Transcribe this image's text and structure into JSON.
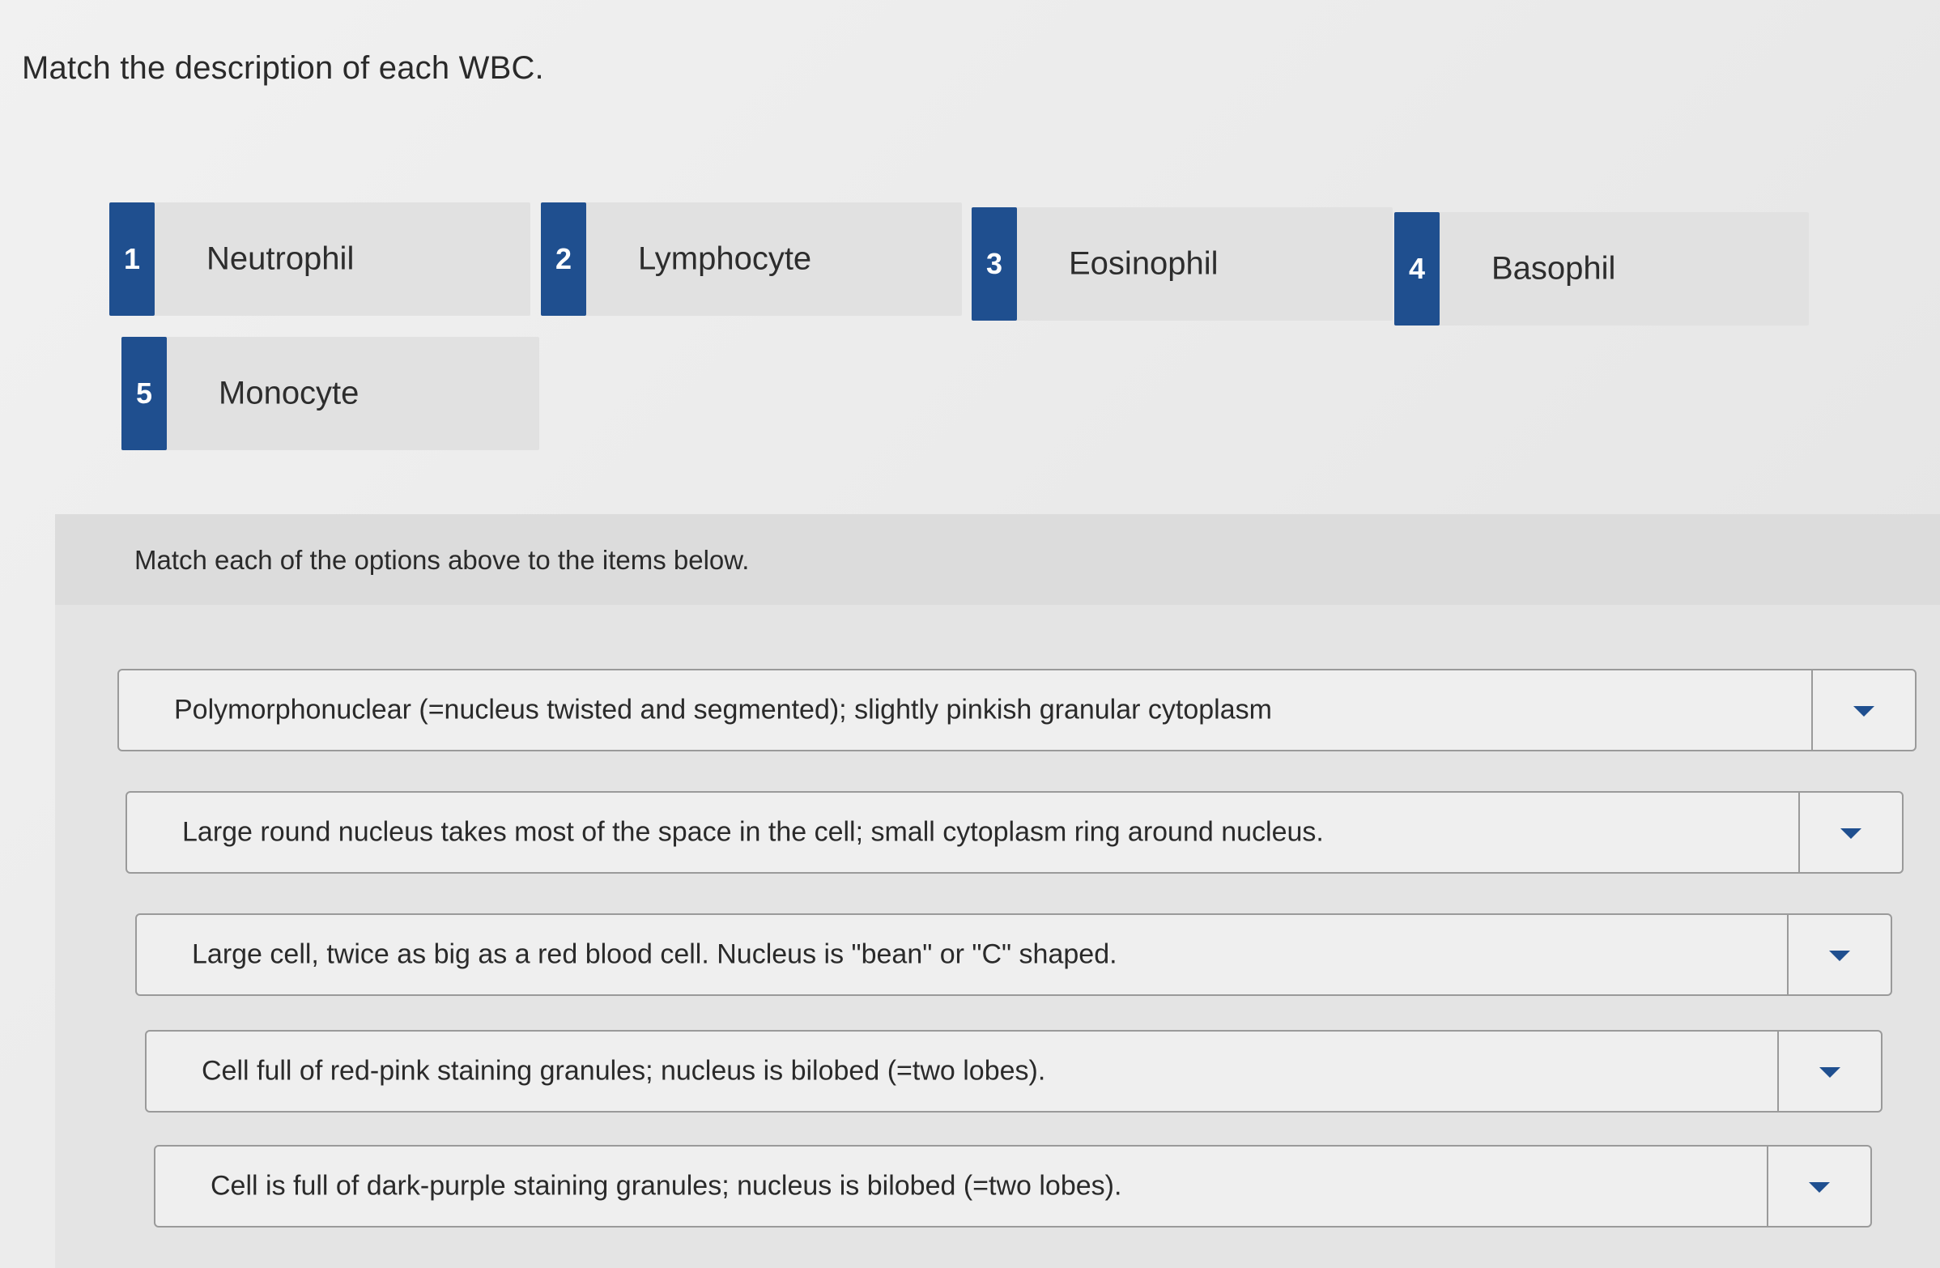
{
  "page": {
    "title": "Match the description of each WBC."
  },
  "options": [
    {
      "number": "1",
      "label": "Neutrophil"
    },
    {
      "number": "2",
      "label": "Lymphocyte"
    },
    {
      "number": "3",
      "label": "Eosinophil"
    },
    {
      "number": "4",
      "label": "Basophil"
    },
    {
      "number": "5",
      "label": "Monocyte"
    }
  ],
  "match_panel": {
    "instruction": "Match each of the options above to the items below.",
    "items": [
      {
        "text": "Polymorphonuclear (=nucleus twisted and segmented); slightly pinkish granular cytoplasm",
        "selected": ""
      },
      {
        "text": "Large round nucleus takes most of the space in the cell; small cytoplasm ring around nucleus.",
        "selected": ""
      },
      {
        "text": "Large cell, twice as big as a red blood cell. Nucleus is \"bean\" or \"C\" shaped.",
        "selected": ""
      },
      {
        "text": "Cell full of red-pink staining granules; nucleus is bilobed (=two lobes).",
        "selected": ""
      },
      {
        "text": "Cell is full of dark-purple staining granules; nucleus is bilobed (=two lobes).",
        "selected": ""
      }
    ],
    "dropdown_icon": "caret-down-icon"
  },
  "colors": {
    "badge": "#1f4f8f",
    "caret": "#1f4f8f",
    "card": "#e1e1e1",
    "panel": "#e4e4e4",
    "row": "#efefef"
  }
}
